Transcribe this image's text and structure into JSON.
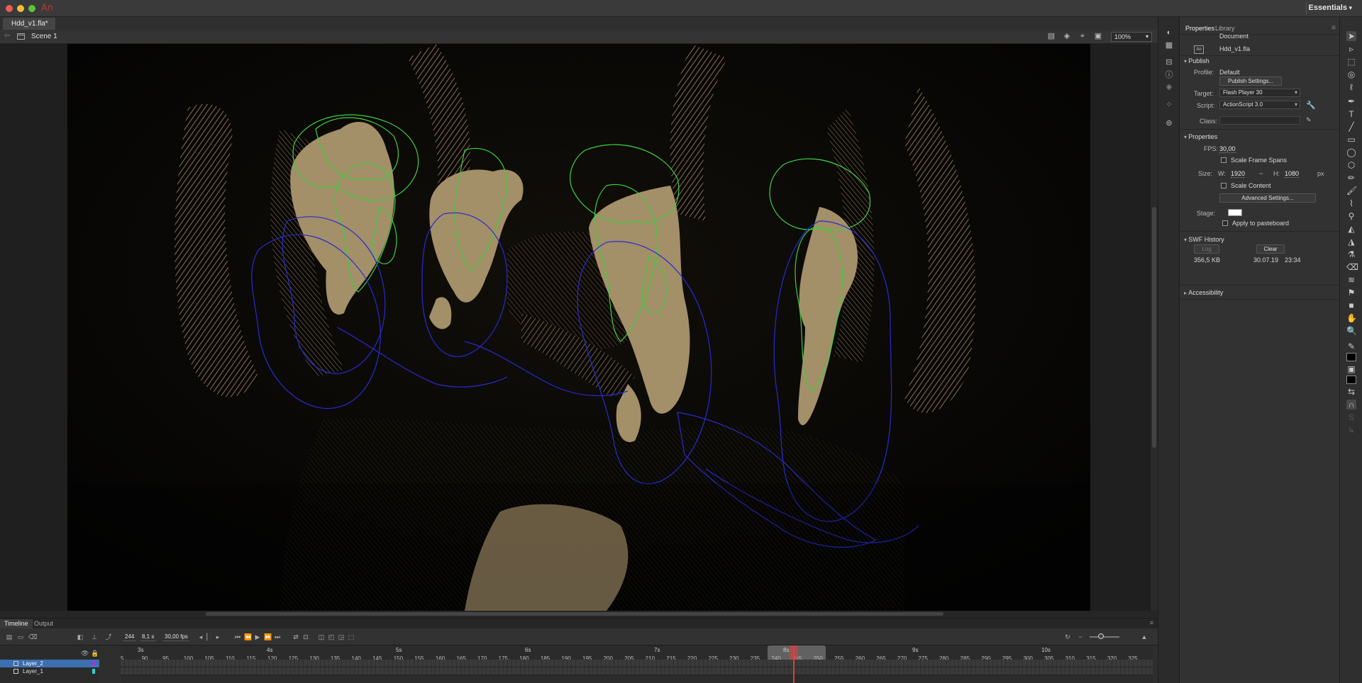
{
  "app": {
    "logo": "An",
    "workspace": "Essentials"
  },
  "document": {
    "tab_title": "Hdd_v1.fla*"
  },
  "editbar": {
    "scene": "Scene 1",
    "zoom": "100%"
  },
  "timeline": {
    "tabs": [
      "Timeline",
      "Output"
    ],
    "current_frame": "244",
    "current_time": "8,1 s",
    "fps": "30,00 fps",
    "layers": [
      {
        "name": "Layer_2",
        "color": "#9b3bd8",
        "selected": true
      },
      {
        "name": "Layer_1",
        "color": "#2ed1d1",
        "selected": false
      }
    ],
    "seconds": [
      "3s",
      "4s",
      "5s",
      "6s",
      "7s",
      "8s",
      "9s",
      "10s"
    ],
    "frame_numbers": [
      "5",
      "90",
      "95",
      "100",
      "105",
      "110",
      "115",
      "120",
      "125",
      "130",
      "135",
      "140",
      "145",
      "150",
      "155",
      "160",
      "165",
      "170",
      "175",
      "180",
      "185",
      "190",
      "195",
      "200",
      "205",
      "210",
      "215",
      "220",
      "225",
      "230",
      "235",
      "240",
      "245",
      "250",
      "255",
      "260",
      "265",
      "270",
      "275",
      "280",
      "285",
      "290",
      "295",
      "300",
      "305",
      "310",
      "315",
      "320",
      "325"
    ]
  },
  "properties": {
    "tabs": [
      "Properties",
      "Library"
    ],
    "doc_type": "Document",
    "doc_icon": "An",
    "file_name": "Hdd_v1.fla",
    "publish": {
      "header": "Publish",
      "profile_label": "Profile:",
      "profile_value": "Default",
      "publish_settings_btn": "Publish Settings...",
      "target_label": "Target:",
      "target_value": "Flash Player 30",
      "script_label": "Script:",
      "script_value": "ActionScript 3.0",
      "class_label": "Class:"
    },
    "props": {
      "header": "Properties",
      "fps_label": "FPS:",
      "fps_value": "30,00",
      "scale_frame_spans": "Scale Frame Spans",
      "size_label": "Size:",
      "w_label": "W:",
      "w_value": "1920",
      "h_label": "H:",
      "h_value": "1080",
      "unit": "px",
      "scale_content": "Scale Content",
      "advanced_btn": "Advanced Settings...",
      "stage_label": "Stage:",
      "stage_color": "#ffffff",
      "apply_pasteboard": "Apply to pasteboard"
    },
    "swf_history": {
      "header": "SWF History",
      "log_btn": "Log",
      "clear_btn": "Clear",
      "size": "356,5 KB",
      "date": "30.07.19",
      "time": "23:34"
    },
    "accessibility": {
      "header": "Accessibility"
    }
  },
  "colors": {
    "fill_shape": "#a38f68",
    "outline_green": "#3ecf3e",
    "outline_blue": "#2a2acf",
    "playhead": "#d94040",
    "selected_layer": "#3d6fb0"
  }
}
